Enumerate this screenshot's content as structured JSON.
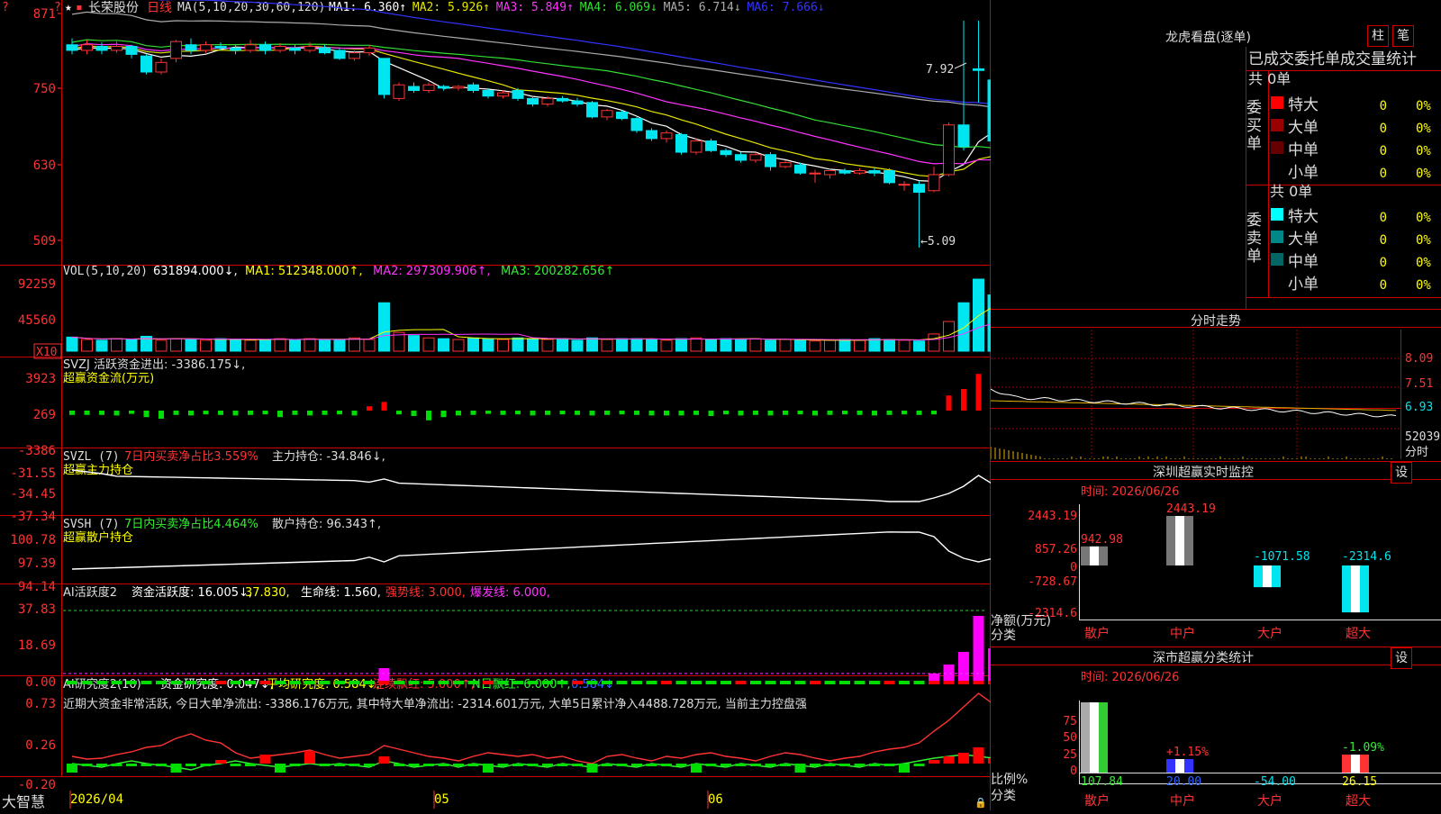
{
  "app": {
    "brand": "大智慧",
    "stock_name": "长荣股份",
    "period": "日线"
  },
  "colors": {
    "up": "#ff3333",
    "down": "#00e6f0",
    "bg": "#000000",
    "frame": "#cc0000",
    "ma1": "#ffffff",
    "ma2": "#e6e600",
    "ma3": "#ff33ff",
    "ma4": "#33dd33",
    "ma5": "#aaaaaa",
    "ma6": "#3333ff"
  },
  "main_panel": {
    "ma_label": "MA(5,10,20,30,60,120)",
    "ma_values": [
      {
        "name": "MA1:",
        "value": "6.360",
        "arrow": "↑",
        "color": "#ffffff"
      },
      {
        "name": "MA2:",
        "value": "5.926",
        "arrow": "↑",
        "color": "#e6e600"
      },
      {
        "name": "MA3:",
        "value": "5.849",
        "arrow": "↑",
        "color": "#ff33ff"
      },
      {
        "name": "MA4:",
        "value": "6.069",
        "arrow": "↓",
        "color": "#33dd33"
      },
      {
        "name": "MA5:",
        "value": "6.714",
        "arrow": "↓",
        "color": "#aaaaaa"
      },
      {
        "name": "MA6:",
        "value": "7.666",
        "arrow": "↓",
        "color": "#3333ff"
      }
    ],
    "y_ticks": [
      "871",
      "750",
      "630",
      "509"
    ],
    "high_label": "7.92",
    "low_label": "←5.09"
  },
  "chart_data": {
    "type": "candlestick",
    "unit_note": "prices in CNY",
    "candles": [
      {
        "o": 7.62,
        "c": 7.55,
        "h": 7.7,
        "l": 7.5
      },
      {
        "o": 7.55,
        "c": 7.62,
        "h": 7.68,
        "l": 7.5
      },
      {
        "o": 7.6,
        "c": 7.55,
        "h": 7.65,
        "l": 7.5
      },
      {
        "o": 7.55,
        "c": 7.6,
        "h": 7.66,
        "l": 7.52
      },
      {
        "o": 7.6,
        "c": 7.5,
        "h": 7.62,
        "l": 7.45
      },
      {
        "o": 7.48,
        "c": 7.28,
        "h": 7.5,
        "l": 7.25
      },
      {
        "o": 7.28,
        "c": 7.4,
        "h": 7.45,
        "l": 7.25
      },
      {
        "o": 7.45,
        "c": 7.66,
        "h": 7.68,
        "l": 7.4
      },
      {
        "o": 7.62,
        "c": 7.55,
        "h": 7.7,
        "l": 7.5
      },
      {
        "o": 7.55,
        "c": 7.62,
        "h": 7.66,
        "l": 7.52
      },
      {
        "o": 7.6,
        "c": 7.58,
        "h": 7.65,
        "l": 7.55
      },
      {
        "o": 7.58,
        "c": 7.55,
        "h": 7.62,
        "l": 7.5
      },
      {
        "o": 7.55,
        "c": 7.62,
        "h": 7.68,
        "l": 7.52
      },
      {
        "o": 7.62,
        "c": 7.55,
        "h": 7.66,
        "l": 7.5
      },
      {
        "o": 7.55,
        "c": 7.6,
        "h": 7.64,
        "l": 7.52
      },
      {
        "o": 7.58,
        "c": 7.55,
        "h": 7.62,
        "l": 7.5
      },
      {
        "o": 7.55,
        "c": 7.6,
        "h": 7.65,
        "l": 7.52
      },
      {
        "o": 7.58,
        "c": 7.52,
        "h": 7.62,
        "l": 7.5
      },
      {
        "o": 7.55,
        "c": 7.45,
        "h": 7.58,
        "l": 7.43
      },
      {
        "o": 7.45,
        "c": 7.52,
        "h": 7.55,
        "l": 7.42
      },
      {
        "o": 7.52,
        "c": 7.58,
        "h": 7.62,
        "l": 7.48
      },
      {
        "o": 7.45,
        "c": 7.0,
        "h": 7.45,
        "l": 6.95
      },
      {
        "o": 6.95,
        "c": 7.12,
        "h": 7.15,
        "l": 6.92
      },
      {
        "o": 7.1,
        "c": 7.05,
        "h": 7.15,
        "l": 7.02
      },
      {
        "o": 7.05,
        "c": 7.12,
        "h": 7.15,
        "l": 7.02
      },
      {
        "o": 7.1,
        "c": 7.08,
        "h": 7.12,
        "l": 7.05
      },
      {
        "o": 7.08,
        "c": 7.1,
        "h": 7.12,
        "l": 7.05
      },
      {
        "o": 7.12,
        "c": 7.05,
        "h": 7.15,
        "l": 7.02
      },
      {
        "o": 7.05,
        "c": 6.98,
        "h": 7.08,
        "l": 6.95
      },
      {
        "o": 6.98,
        "c": 7.02,
        "h": 7.05,
        "l": 6.95
      },
      {
        "o": 7.05,
        "c": 6.95,
        "h": 7.08,
        "l": 6.92
      },
      {
        "o": 6.95,
        "c": 6.88,
        "h": 6.98,
        "l": 6.85
      },
      {
        "o": 6.88,
        "c": 6.95,
        "h": 6.98,
        "l": 6.85
      },
      {
        "o": 6.95,
        "c": 6.92,
        "h": 6.98,
        "l": 6.9
      },
      {
        "o": 6.92,
        "c": 6.88,
        "h": 6.96,
        "l": 6.85
      },
      {
        "o": 6.9,
        "c": 6.72,
        "h": 6.92,
        "l": 6.7
      },
      {
        "o": 6.72,
        "c": 6.8,
        "h": 6.82,
        "l": 6.68
      },
      {
        "o": 6.78,
        "c": 6.7,
        "h": 6.8,
        "l": 6.68
      },
      {
        "o": 6.7,
        "c": 6.55,
        "h": 6.72,
        "l": 6.52
      },
      {
        "o": 6.55,
        "c": 6.45,
        "h": 6.58,
        "l": 6.42
      },
      {
        "o": 6.45,
        "c": 6.52,
        "h": 6.55,
        "l": 6.4
      },
      {
        "o": 6.5,
        "c": 6.28,
        "h": 6.52,
        "l": 6.25
      },
      {
        "o": 6.28,
        "c": 6.42,
        "h": 6.45,
        "l": 6.25
      },
      {
        "o": 6.42,
        "c": 6.3,
        "h": 6.45,
        "l": 6.28
      },
      {
        "o": 6.3,
        "c": 6.25,
        "h": 6.33,
        "l": 6.22
      },
      {
        "o": 6.25,
        "c": 6.18,
        "h": 6.28,
        "l": 6.15
      },
      {
        "o": 6.18,
        "c": 6.25,
        "h": 6.28,
        "l": 6.15
      },
      {
        "o": 6.25,
        "c": 6.1,
        "h": 6.28,
        "l": 6.05
      },
      {
        "o": 6.1,
        "c": 6.15,
        "h": 6.18,
        "l": 6.08
      },
      {
        "o": 6.12,
        "c": 6.02,
        "h": 6.15,
        "l": 6.0
      },
      {
        "o": 6.02,
        "c": 6.02,
        "h": 6.06,
        "l": 5.9
      },
      {
        "o": 6.0,
        "c": 6.05,
        "h": 6.08,
        "l": 5.95
      },
      {
        "o": 6.05,
        "c": 6.02,
        "h": 6.08,
        "l": 6.0
      },
      {
        "o": 6.02,
        "c": 6.05,
        "h": 6.08,
        "l": 6.0
      },
      {
        "o": 6.05,
        "c": 6.02,
        "h": 6.08,
        "l": 5.98
      },
      {
        "o": 6.05,
        "c": 5.9,
        "h": 6.08,
        "l": 5.88
      },
      {
        "o": 5.88,
        "c": 5.88,
        "h": 5.92,
        "l": 5.8
      },
      {
        "o": 5.88,
        "c": 5.78,
        "h": 5.92,
        "l": 5.09
      },
      {
        "o": 5.8,
        "c": 6.0,
        "h": 6.1,
        "l": 5.78
      },
      {
        "o": 6.0,
        "c": 6.62,
        "h": 6.65,
        "l": 5.98
      },
      {
        "o": 6.62,
        "c": 6.35,
        "h": 7.92,
        "l": 6.3
      },
      {
        "o": 7.32,
        "c": 7.3,
        "h": 7.92,
        "l": 6.9
      },
      {
        "o": 7.18,
        "c": 6.42,
        "h": 7.28,
        "l": 6.4
      }
    ],
    "volume_x10": [
      18000,
      15000,
      14000,
      16000,
      15000,
      19000,
      14000,
      16000,
      15000,
      14000,
      16000,
      15000,
      14000,
      15000,
      16000,
      15000,
      16000,
      14000,
      15000,
      17000,
      15000,
      62000,
      24000,
      20000,
      17000,
      16000,
      15000,
      17000,
      16000,
      15000,
      17000,
      16000,
      15000,
      16000,
      14000,
      17000,
      15000,
      16000,
      16000,
      15000,
      14000,
      16000,
      17000,
      15000,
      16000,
      15000,
      16000,
      14000,
      15000,
      14000,
      13000,
      14000,
      15000,
      14000,
      16000,
      15000,
      14000,
      13000,
      22000,
      38000,
      62000,
      92259,
      72000
    ],
    "volume_ma_values": {
      "vol": "631894.000",
      "ma1": "512348.000",
      "ma2": "297309.906",
      "ma3": "200282.656"
    },
    "x_axis_labels": [
      "2026/04",
      "05",
      "06"
    ]
  },
  "vol_panel": {
    "label": "VOL(5,10,20)",
    "items": [
      {
        "text": "631894.000↓,",
        "color": "#ffffff"
      },
      {
        "text": "MA1: 512348.000↑,",
        "color": "#ffff00"
      },
      {
        "text": "MA2: 297309.906↑,",
        "color": "#ff33ff"
      },
      {
        "text": "MA3: 200282.656↑",
        "color": "#33ee33"
      }
    ],
    "y_ticks": [
      "92259",
      "45560"
    ],
    "scale_box": "X10"
  },
  "svzj_panel": {
    "line1": "SVZJ  活跃资金进出: -3386.175↓,",
    "line2": "超赢资金流(万元)",
    "y_ticks": [
      "3923",
      "269",
      "-3386"
    ],
    "values": [
      -8,
      -8,
      -8,
      -9,
      -6,
      -12,
      -15,
      -8,
      -9,
      -7,
      -8,
      -9,
      -8,
      -7,
      -12,
      -8,
      -9,
      -8,
      -7,
      -9,
      8,
      16,
      -7,
      -10,
      -18,
      -12,
      -9,
      -8,
      -6,
      -8,
      -7,
      -9,
      -8,
      -7,
      -8,
      -9,
      -8,
      -7,
      -8,
      -9,
      -9,
      -9,
      -8,
      -10,
      -7,
      -9,
      -8,
      -9,
      -8,
      -7,
      -9,
      -8,
      -7,
      -8,
      -9,
      -8,
      -7,
      -8,
      -7,
      28,
      40,
      68,
      -60
    ]
  },
  "svzl_panel": {
    "prefix": "SVZL (7)",
    "red_text": "7日内买卖净占比3.559%",
    "white_text": "主力持仓: -34.846↓,",
    "label2": "超赢主力持仓",
    "y_ticks": [
      "-31.55",
      "-34.45",
      "-37.34"
    ]
  },
  "svsh_panel": {
    "prefix": "SVSH (7)",
    "green_text": "7日内买卖净占比4.464%",
    "white_text": "散户持仓: 96.343↑,",
    "label2": "超赢散户持仓",
    "y_ticks": [
      "100.78",
      "97.39",
      "94.14"
    ]
  },
  "ai_active_panel": {
    "label": "AI活跃度2",
    "items": [
      {
        "text": "资金活跃度: 16.005↓,",
        "color": "#ffffff"
      },
      {
        "text": "37.830,",
        "color": "#ffff00"
      },
      {
        "text": "生命线: 1.560,",
        "color": "#ffffff"
      },
      {
        "text": "强势线: 3.000,",
        "color": "#ff3333"
      },
      {
        "text": "爆发线: 6.000,",
        "color": "#ff33ff"
      }
    ],
    "y_ticks": [
      "37.83",
      "18.69",
      "0.00"
    ]
  },
  "ai_research_panel": {
    "label": "AI研究度2(10)",
    "items": [
      {
        "text": "资金研究度: 0.047↓,",
        "color": "#ffffff"
      },
      {
        "text": "平均研究度: 0.584↓,",
        "color": "#ffff00"
      },
      {
        "text": "连续飘红: 5.000↑,",
        "color": "#ff3333"
      },
      {
        "text": "N日飘红: 6.000↑,",
        "color": "#33ee33"
      },
      {
        "text": "0.584↓",
        "color": "#3366ff"
      }
    ],
    "comment": "近期大资金非常活跃, 今日大单净流出: -3386.176万元, 其中特大单净流出: -2314.601万元, 大单5日累计净入4488.728万元, 当前主力控盘强",
    "y_ticks": [
      "0.73",
      "0.26",
      "-0.20"
    ]
  },
  "right_panel": {
    "lhb_title": "龙虎看盘(逐单)",
    "btn_bar": "柱",
    "btn_stroke": "笔",
    "stats_header": "已成交委托单成交量统计",
    "buy_side": {
      "side_label": "委买单",
      "total": "共 0单",
      "rows": [
        {
          "label": "特大",
          "count": "0",
          "pct": "0%",
          "color": "#ff0000"
        },
        {
          "label": "大单",
          "count": "0",
          "pct": "0%",
          "color": "#990000"
        },
        {
          "label": "中单",
          "count": "0",
          "pct": "0%",
          "color": "#660000"
        },
        {
          "label": "小单",
          "count": "0",
          "pct": "0%",
          "color": ""
        }
      ]
    },
    "sell_side": {
      "side_label": "委卖单",
      "total": "共 0单",
      "rows": [
        {
          "label": "特大",
          "count": "0",
          "pct": "0%",
          "color": "#00ffff"
        },
        {
          "label": "大单",
          "count": "0",
          "pct": "0%",
          "color": "#008888"
        },
        {
          "label": "中单",
          "count": "0",
          "pct": "0%",
          "color": "#006666"
        },
        {
          "label": "小单",
          "count": "0",
          "pct": "0%",
          "color": ""
        }
      ]
    },
    "intraday": {
      "title": "分时走势",
      "y_ticks": [
        "8.09",
        "7.51",
        "6.93",
        "52039"
      ],
      "unit_label": "分时"
    },
    "monitor": {
      "title": "深圳超赢实时监控",
      "btn": "设",
      "time": "时间: 2026/06/26",
      "y_ticks": [
        "2443.19",
        "857.26",
        "0",
        "-728.67",
        "-2314.6"
      ],
      "y_caption": "净额(万元)",
      "x_caption": "分类",
      "categories": [
        "散户",
        "中户",
        "大户",
        "超大"
      ],
      "values": [
        942.98,
        2443.19,
        -1071.58,
        -2314.6
      ],
      "value_labels": [
        "942.98",
        "2443.19",
        "-1071.58",
        "-2314.6"
      ]
    },
    "classify": {
      "title": "深市超赢分类统计",
      "btn": "设",
      "time": "时间: 2026/06/26",
      "y_ticks": [
        "75",
        "50",
        "25",
        "0"
      ],
      "y_caption": "比例%",
      "x_caption": "分类",
      "categories": [
        "散户",
        "中户",
        "大户",
        "超大"
      ],
      "bar_pct": [
        78,
        15,
        0,
        20
      ],
      "pct_labels": [
        "",
        "+1.15%",
        "",
        "-1.09%"
      ],
      "amount_labels": [
        "107.84",
        "20.00",
        "-54.00",
        "26.15"
      ]
    }
  }
}
